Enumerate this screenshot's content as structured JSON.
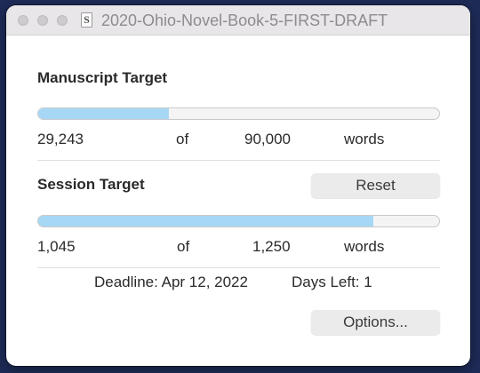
{
  "window": {
    "title": "2020-Ohio-Novel-Book-5-FIRST-DRAFT",
    "doc_icon_glyph": "S",
    "doc_icon_name": "scrivener-document-icon"
  },
  "manuscript": {
    "heading": "Manuscript Target",
    "current": "29,243",
    "of_label": "of",
    "target": "90,000",
    "unit": "words",
    "progress_fraction": 0.325
  },
  "session": {
    "heading": "Session Target",
    "reset_label": "Reset",
    "current": "1,045",
    "of_label": "of",
    "target": "1,250",
    "unit": "words",
    "progress_fraction": 0.836
  },
  "footer": {
    "deadline": "Deadline: Apr 12, 2022",
    "days_left": "Days Left: 1",
    "options_label": "Options..."
  },
  "colors": {
    "progress_fill": "#a6d8f6",
    "desktop_background": "#1e2b57"
  }
}
